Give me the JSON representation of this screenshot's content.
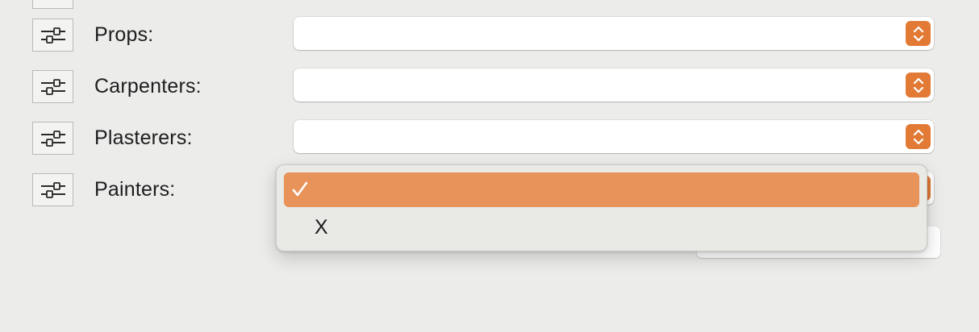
{
  "colors": {
    "accent": "#e27a36",
    "highlight": "#e8935a",
    "background": "#ececea"
  },
  "rows": [
    {
      "label": "",
      "icon": "sliders-icon"
    },
    {
      "label": "Props:",
      "icon": "sliders-icon",
      "value": ""
    },
    {
      "label": "Carpenters:",
      "icon": "sliders-icon",
      "value": ""
    },
    {
      "label": "Plasterers:",
      "icon": "sliders-icon",
      "value": ""
    },
    {
      "label": "Painters:",
      "icon": "sliders-icon",
      "value": ""
    }
  ],
  "dropdown_menu": {
    "items": [
      {
        "label": "",
        "checked": true,
        "icon": "checkmark-icon"
      },
      {
        "label": "X",
        "checked": false
      }
    ]
  }
}
